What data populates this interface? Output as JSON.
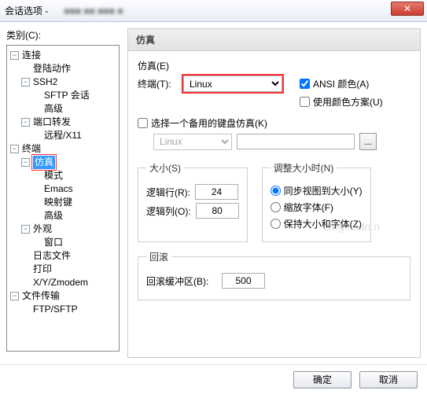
{
  "window": {
    "title": "会话选项 -",
    "close_icon": "✕"
  },
  "left": {
    "category_label": "类别(C):",
    "tree": {
      "connection": {
        "label": "连接",
        "login": "登陆动作",
        "ssh2": "SSH2",
        "sftp": "SFTP 会话",
        "advanced": "高级",
        "portfwd": "端口转发",
        "remote": "远程/X11"
      },
      "terminal": {
        "label": "终端",
        "emulation": "仿真",
        "mode": "模式",
        "emacs": "Emacs",
        "mapkey": "映射键",
        "advanced": "高级",
        "appearance": "外观",
        "window": "窗口",
        "logfile": "日志文件",
        "print": "打印",
        "xyz": "X/Y/Zmodem"
      },
      "file": {
        "label": "文件传输",
        "ftp": "FTP/SFTP"
      }
    }
  },
  "right": {
    "title": "仿真",
    "emu_label": "仿真(E)",
    "term_label": "终端(T):",
    "term_value": "Linux",
    "ansi_color": "ANSI 颜色(A)",
    "use_scheme": "使用颜色方案(U)",
    "keymap_check": "选择一个备用的键盘仿真(K)",
    "keymap_value": "Linux",
    "keymap_btn": "...",
    "size": {
      "legend": "大小(S)",
      "rows_label": "逻辑行(R):",
      "rows_value": "24",
      "cols_label": "逻辑列(O):",
      "cols_value": "80"
    },
    "resize": {
      "legend": "调整大小时(N)",
      "sync": "同步视图到大小(Y)",
      "scale": "缩放字体(F)",
      "keep": "保持大小和字体(Z)"
    },
    "scroll": {
      "legend": "回滚",
      "buffer_label": "回滚缓冲区(B):",
      "buffer_value": "500"
    }
  },
  "footer": {
    "ok": "确定",
    "cancel": "取消"
  },
  "watermark": "blog.csdn.n"
}
